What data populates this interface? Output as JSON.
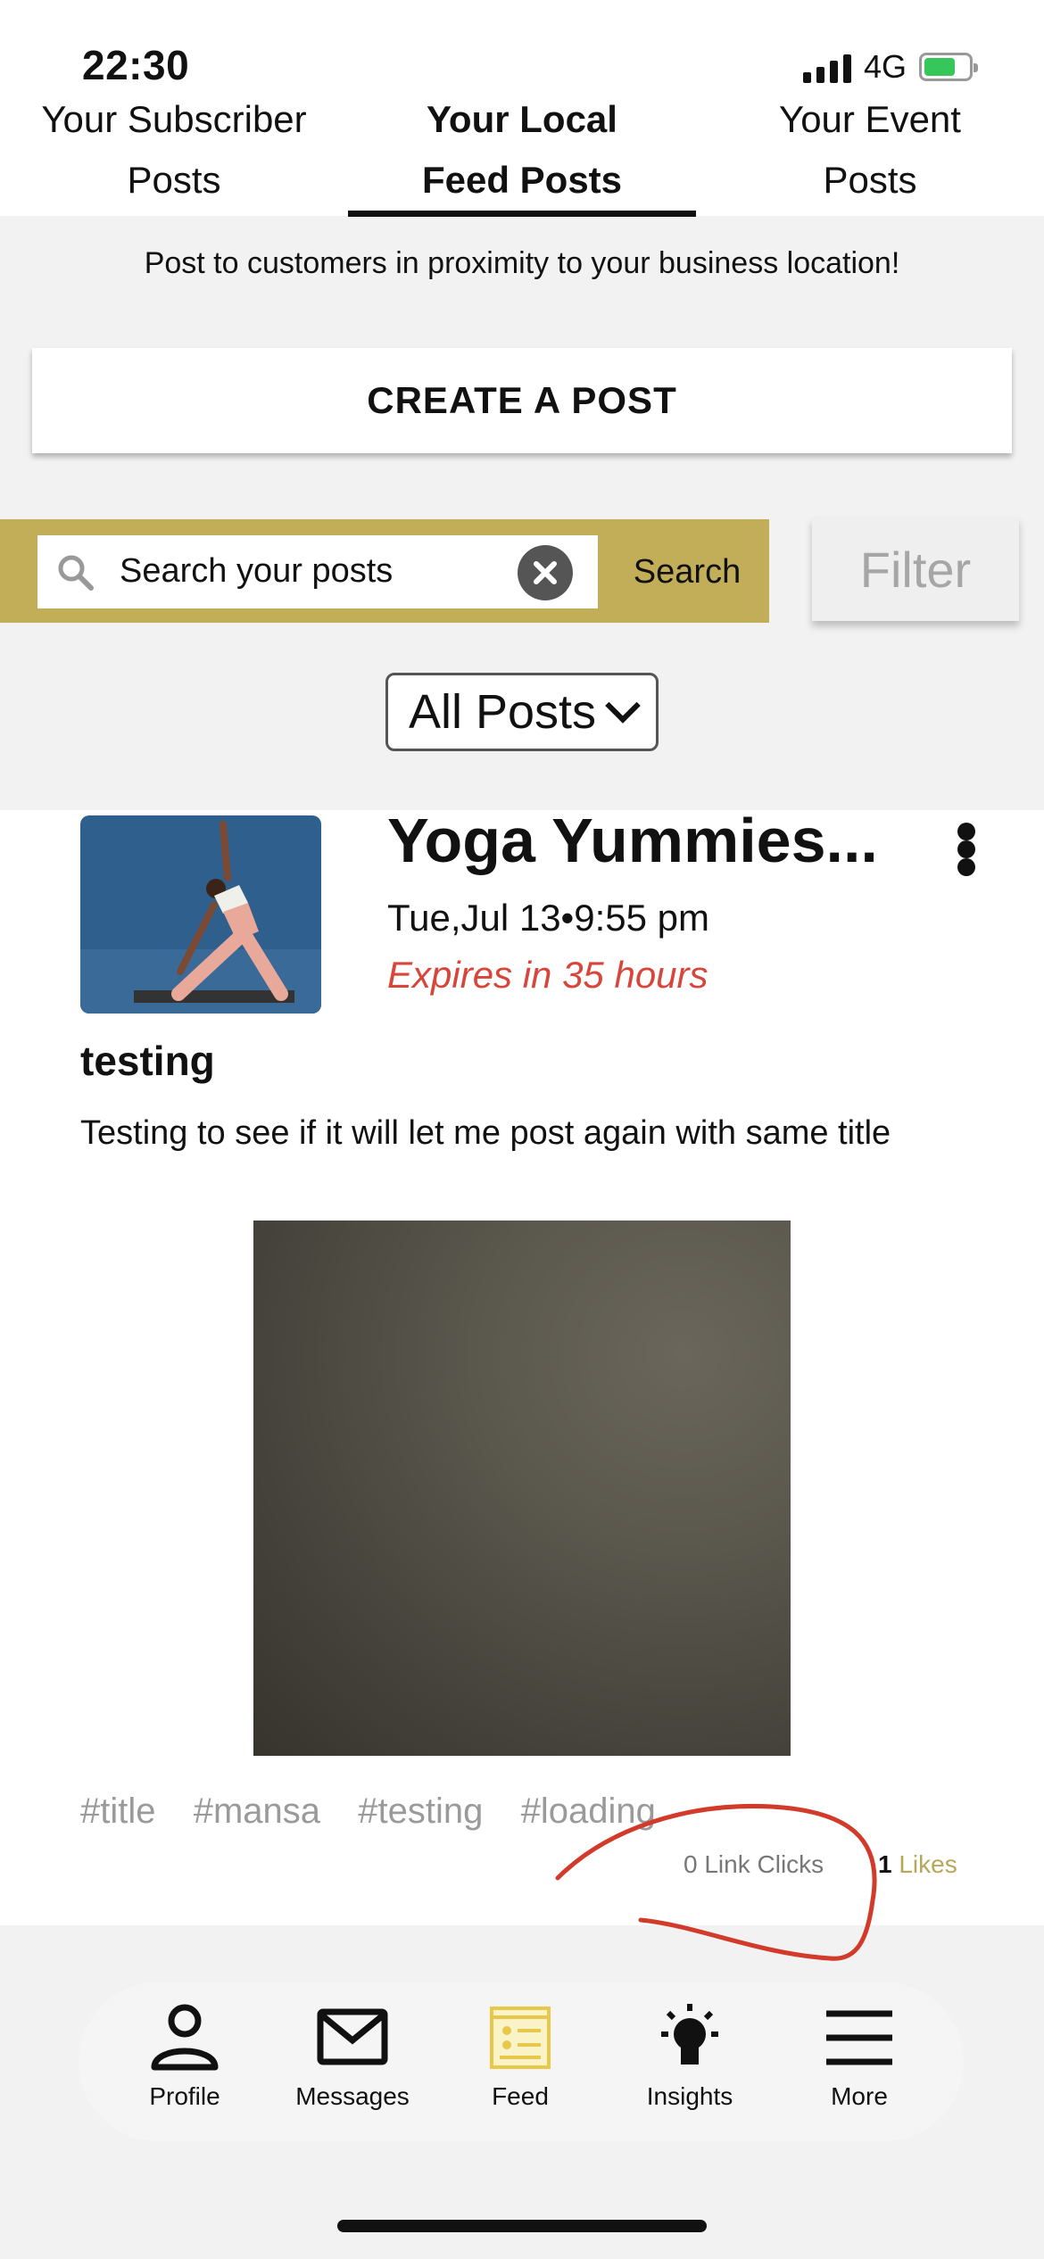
{
  "status_bar": {
    "time": "22:30",
    "network": "4G"
  },
  "tabs": [
    {
      "line1": "Your Subscriber",
      "line2": "Posts",
      "active": false
    },
    {
      "line1": "Your Local",
      "line2": "Feed Posts",
      "active": true
    },
    {
      "line1": "Your Event",
      "line2": "Posts",
      "active": false
    }
  ],
  "intro_text": "Post to customers in proximity to your business location!",
  "create_button": "CREATE A POST",
  "search": {
    "value": "Search your posts",
    "button_label": "Search"
  },
  "filter_label": "Filter",
  "post_filter": {
    "selected": "All Posts"
  },
  "post": {
    "business_name": "Yoga Yummies...",
    "date": "Tue,Jul 13•9:55 pm",
    "expires": "Expires in 35 hours",
    "title": "testing",
    "body": "Testing to see if it will let me post again with same title",
    "hashtags": "#title  #mansa  #testing  #loading",
    "link_clicks": "0 Link Clicks",
    "likes_count": "1",
    "likes_label": "Likes"
  },
  "bottom_nav": [
    {
      "label": "Profile",
      "icon": "person-icon"
    },
    {
      "label": "Messages",
      "icon": "envelope-icon"
    },
    {
      "label": "Feed",
      "icon": "feed-icon",
      "active": true
    },
    {
      "label": "Insights",
      "icon": "lightbulb-icon"
    },
    {
      "label": "More",
      "icon": "hamburger-menu-icon"
    }
  ],
  "colors": {
    "accent_gold": "#c2ad58",
    "expires_red": "#d8453a",
    "feed_icon_gold": "#e8c84a"
  }
}
